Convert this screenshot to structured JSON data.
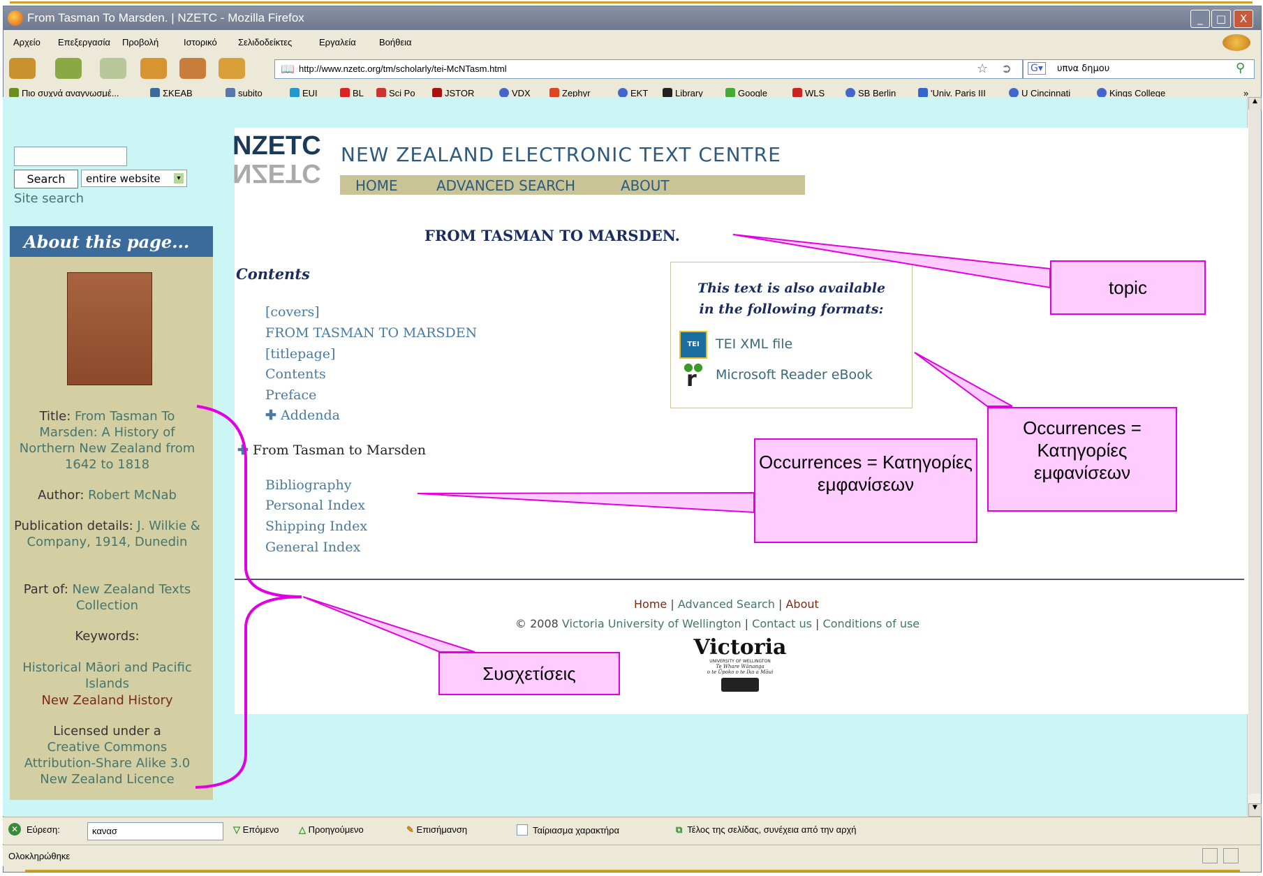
{
  "window": {
    "title": "From Tasman To Marsden.  |  NZETC - Mozilla Firefox",
    "minimize": "_",
    "maximize": "□",
    "close": "X"
  },
  "menu": [
    "Αρχείο",
    "Επεξεργασία",
    "Προβολή",
    "Ιστορικό",
    "Σελιδοδείκτες",
    "Εργαλεία",
    "Βοήθεια"
  ],
  "navbar": {
    "url": "http://www.nzetc.org/tm/scholarly/tei-McNTasm.html",
    "search_value": "υπνα δημου"
  },
  "bookmarks": [
    {
      "label": "Πιο συχνά αναγνωσμέ...",
      "color": "#6b8e23"
    },
    {
      "label": "ΣΚΕΑΒ",
      "color": "#3a6b9a"
    },
    {
      "label": "subito",
      "color": "#5577aa"
    },
    {
      "label": "EUI",
      "color": "#2299cc"
    },
    {
      "label": "BL",
      "color": "#dd2222"
    },
    {
      "label": "Sci Po",
      "color": "#cc3333"
    },
    {
      "label": "JSTOR",
      "color": "#aa1111"
    },
    {
      "label": "VDX",
      "color": "#4466cc"
    },
    {
      "label": "Zephyr",
      "color": "#dd4422"
    },
    {
      "label": "EKT",
      "color": "#4466cc"
    },
    {
      "label": "Library",
      "color": "#222222"
    },
    {
      "label": "Google",
      "color": "#44aa33"
    },
    {
      "label": "WLS",
      "color": "#cc2222"
    },
    {
      "label": "SB Berlin",
      "color": "#4466cc"
    },
    {
      "label": "'Univ. Paris III",
      "color": "#3366cc"
    },
    {
      "label": "U Cincinnati",
      "color": "#4466cc"
    },
    {
      "label": "Kings College",
      "color": "#4466cc"
    }
  ],
  "bookmarks_more": "»",
  "sidebar": {
    "search_button": "Search",
    "scope": "entire website",
    "site_search": "Site search",
    "about_header": "About this page...",
    "title_label": "Title",
    "title_value": "From Tasman To Marsden: A History of Northern New Zealand from 1642 to 1818",
    "author_label": "Author",
    "author_value": "Robert McNab",
    "pub_label": "Publication details",
    "pub_value": "J. Wilkie & Company, 1914, Dunedin",
    "partof_label": "Part of",
    "partof_value": "New Zealand Texts Collection",
    "keywords_label": "Keywords:",
    "keyword1": "Historical Māori and Pacific Islands",
    "keyword2": "New Zealand History",
    "license_intro": "Licensed under a",
    "license": "Creative Commons Attribution-Share Alike 3.0 New Zealand Licence"
  },
  "site": {
    "logo": "NZETC",
    "name": "NEW ZEALAND ELECTRONIC TEXT CENTRE",
    "nav": [
      "HOME",
      "ADVANCED SEARCH",
      "ABOUT"
    ]
  },
  "page": {
    "heading": "FROM TASMAN TO MARSDEN.",
    "contents_heading": "Contents",
    "toc": [
      "[covers]",
      "FROM TASMAN TO MARSDEN",
      "[titlepage]",
      "Contents",
      "Preface"
    ],
    "addenda": "Addenda",
    "section": "From Tasman to Marsden",
    "indexes": [
      "Bibliography",
      "Personal Index",
      "Shipping Index",
      "General Index"
    ],
    "formats_title_1": "This text is also available",
    "formats_title_2": "in the following formats:",
    "formats": [
      "TEI XML file",
      "Microsoft Reader eBook"
    ]
  },
  "footer": {
    "links": [
      "Home",
      "Advanced Search",
      "About"
    ],
    "copyright": "© 2008",
    "university": "Victoria University of Wellington",
    "contact": "Contact us",
    "conditions": "Conditions of use",
    "seal_name": "Victoria",
    "seal_sub": "UNIVERSITY OF WELLINGTON",
    "seal_maori_1": "Te Whare Wānanga",
    "seal_maori_2": "o te Ūpoko o te Ika a Māui"
  },
  "findbar": {
    "label": "Εύρεση:",
    "value": "κανασ",
    "next": "Επόμενο",
    "prev": "Προηγούμενο",
    "highlight": "Επισήμανση",
    "match_case": "Ταίριασμα χαρακτήρα",
    "status": "Τέλος της σελίδας, συνέχεια από την αρχή"
  },
  "statusbar": {
    "text": "Ολοκληρώθηκε"
  },
  "callouts": {
    "topic": "topic",
    "occurrences_right": "Occurrences = Κατηγορίες εμφανίσεων",
    "occurrences_mid": "Occurrences = Κατηγορίες εμφανίσεων",
    "associations": "Συσχετίσεις"
  },
  "colors": {
    "callout_fill": "#ffccff",
    "callout_stroke": "#e000e0",
    "page_bg": "#ccf5f5",
    "sidebar": "#d4cfa2"
  }
}
